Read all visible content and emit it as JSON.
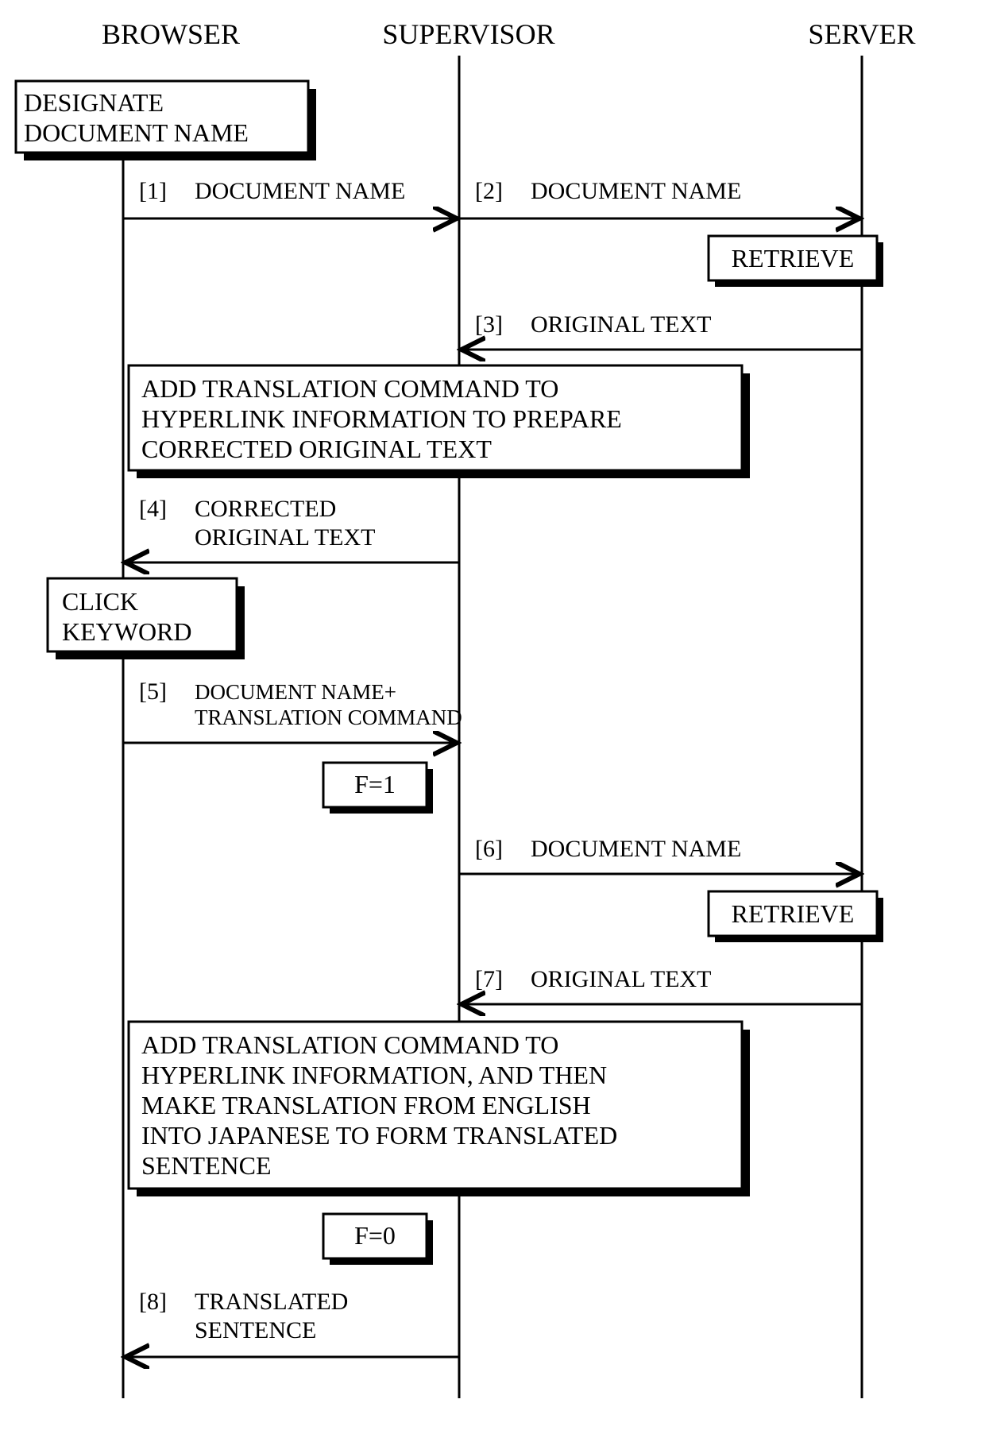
{
  "actors": {
    "browser": "BROWSER",
    "supervisor": "SUPERVISOR",
    "server": "SERVER"
  },
  "boxes": {
    "designate": "DESIGNATE\nDOCUMENT NAME",
    "retrieve1": "RETRIEVE",
    "process1": "ADD TRANSLATION COMMAND TO\nHYPERLINK INFORMATION TO PREPARE\nCORRECTED ORIGINAL TEXT",
    "click": "CLICK\nKEYWORD",
    "fset": "F=1",
    "retrieve2": "RETRIEVE",
    "process2": "ADD TRANSLATION COMMAND TO\nHYPERLINK INFORMATION, AND THEN\nMAKE TRANSLATION FROM ENGLISH\nINTO JAPANESE TO FORM TRANSLATED\nSENTENCE",
    "freset": "F=0"
  },
  "messages": {
    "m1": {
      "num": "[1]",
      "text": "DOCUMENT NAME"
    },
    "m2": {
      "num": "[2]",
      "text": "DOCUMENT NAME"
    },
    "m3": {
      "num": "[3]",
      "text": "ORIGINAL TEXT"
    },
    "m4": {
      "num": "[4]",
      "text": "CORRECTED\nORIGINAL TEXT"
    },
    "m5": {
      "num": "[5]",
      "text": "DOCUMENT NAME+\nTRANSLATION COMMAND"
    },
    "m6": {
      "num": "[6]",
      "text": "DOCUMENT NAME"
    },
    "m7": {
      "num": "[7]",
      "text": "ORIGINAL TEXT"
    },
    "m8": {
      "num": "[8]",
      "text": "TRANSLATED\nSENTENCE"
    }
  }
}
